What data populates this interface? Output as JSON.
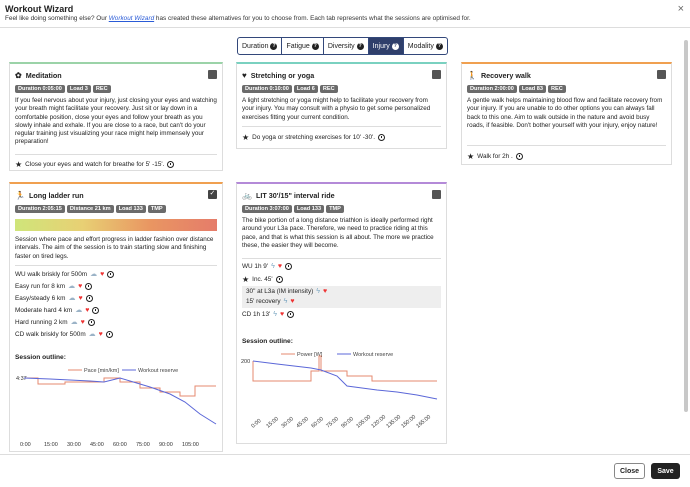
{
  "header": {
    "title": "Workout Wizard",
    "subtitle_pre": "Feel like doing something else? Our ",
    "subtitle_link": "Workout Wizard",
    "subtitle_post": " has created these alternatives for you to choose from. Each tab represents what the sessions are optimised for.",
    "close_glyph": "×"
  },
  "tabs": [
    {
      "label": "Duration",
      "active": false
    },
    {
      "label": "Fatigue",
      "active": false
    },
    {
      "label": "Diversity",
      "active": false
    },
    {
      "label": "Injury",
      "active": true
    },
    {
      "label": "Modality",
      "active": false
    }
  ],
  "cards": {
    "meditation": {
      "title": "Meditation",
      "icon": "brain-icon",
      "accent": "#9bd3a8",
      "badges": [
        "Duration 0:05:00",
        "Load 3",
        "REC"
      ],
      "description": "If you feel nervous about your injury, just closing your eyes and watching your breath might facilitate your recovery. Just sit or lay down in a comfortable position, close your eyes and follow your breath as you slowly inhale and exhale. If you are close to a race, but can't do your regular training just visualizing your race might help immensely your preparation!",
      "tip": "Close your eyes and watch for breathe for 5' -15'."
    },
    "stretching": {
      "title": "Stretching or yoga",
      "icon": "heart-icon",
      "accent": "#7ad1c0",
      "badges": [
        "Duration 0:10:00",
        "Load 6",
        "REC"
      ],
      "description": "A light stretching or yoga might help to facilitate your recovery from your injury. You may consult with a physio to get some personalized exercises fitting your current condition.",
      "tip": "Do yoga or stretching exercises for 10' -30'."
    },
    "recovery": {
      "title": "Recovery walk",
      "icon": "walking-icon",
      "accent": "#f0a050",
      "badges": [
        "Duration 2:00:00",
        "Load 83",
        "REC"
      ],
      "description": "A gentle walk helps maintaining blood flow and facilitate recovery from your injury. If you are unable to do other options you can always fall back to this one. Aim to walk outside in the nature and avoid busy roads, if feasible. Don't bother yourself with your injury, enjoy nature!",
      "tip": "Walk for 2h ."
    },
    "ladder": {
      "title": "Long ladder run",
      "icon": "running-icon",
      "accent": "#f0a050",
      "badges": [
        "Duration 2:05:15",
        "Distance 21 km",
        "Load 133",
        "TMP"
      ],
      "description": "Session where pace and effort progress in ladder fashion over distance intervals. The aim of the session is to train starting slow and finishing faster on tired legs.",
      "steps": [
        "WU walk briskly for 500m",
        "Easy run for 8 km",
        "Easy/steady 6 km",
        "Moderate hard 4 km",
        "Hard running 2 km",
        "CD walk briskly for 500m"
      ],
      "outline_title": "Session outline:",
      "legend_pace": "Pace [min/km]",
      "legend_reserve": "Workout reserve",
      "y_label": "4:37",
      "x_ticks": [
        "0:00",
        "15:00",
        "30:00",
        "45:00",
        "60:00",
        "75:00",
        "90:00",
        "105:00"
      ]
    },
    "lit": {
      "title": "LIT 30'/15\" interval ride",
      "icon": "bike-icon",
      "accent": "#b48ad8",
      "badges": [
        "Duration 3:07:00",
        "Load 133",
        "TMP"
      ],
      "description": "The bike portion of a long distance triathlon is ideally performed right around your L3a pace. Therefore, we need to practice riding at this pace, and that is what this session is all about. The more we practice these, the easier they will become.",
      "steps": [
        "WU 1h 9'",
        "Inc. 45'",
        "30\" at L3a (IM intensity)",
        "15' recovery",
        "CD 1h 13'"
      ],
      "outline_title": "Session outline:",
      "legend_power": "Power [W]",
      "legend_reserve": "Workout reserve",
      "y_label": "200",
      "x_ticks": [
        "0:00",
        "15:00",
        "30:00",
        "45:00",
        "60:00",
        "75:00",
        "90:00",
        "105:00",
        "120:00",
        "135:00",
        "150:00",
        "165:00"
      ]
    }
  },
  "footer": {
    "close_label": "Close",
    "save_label": "Save"
  }
}
